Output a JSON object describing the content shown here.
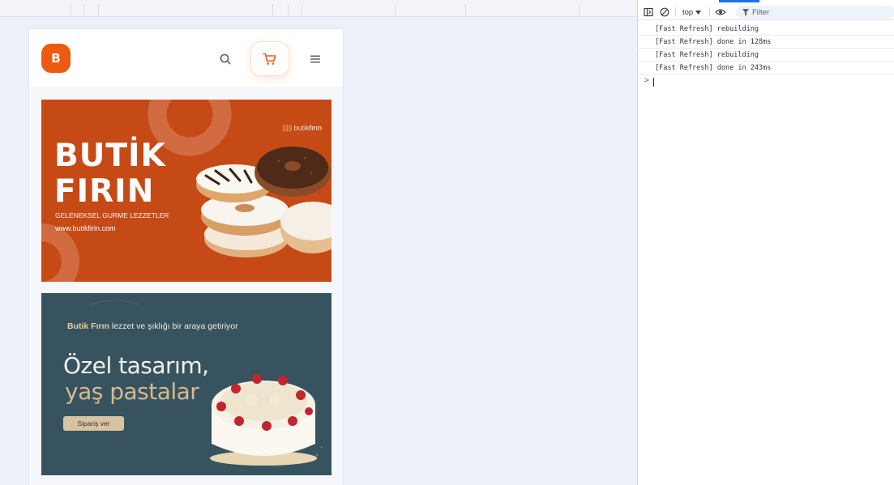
{
  "header": {
    "logo_letter": "B",
    "icons": [
      "search-icon",
      "cart-icon",
      "menu-icon"
    ],
    "accent_color": "#ee5a10"
  },
  "banner1": {
    "brand_prefix": "butik",
    "brand_suffix": "fırın",
    "title_line1": "BUTİK",
    "title_line2": "FIRIN",
    "subtitle": "GELENEKSEL GURME LEZZETLER",
    "url": "www.butikfirin.com",
    "background": "#c64a16"
  },
  "banner2": {
    "tag_brand": "Butik Fırın",
    "tag_rest": " lezzet ve şıklığı bir araya getiriyor",
    "title_line1": "Özel tasarım,",
    "title_line2": "yaş pastalar",
    "button_label": "Sipariş ver",
    "background": "#37535f"
  },
  "devtools": {
    "context": "top",
    "filter_placeholder": "Filter",
    "console_lines": [
      "[Fast Refresh] rebuilding",
      "[Fast Refresh] done in 128ms",
      "[Fast Refresh] rebuilding",
      "[Fast Refresh] done in 243ms"
    ],
    "prompt": ">"
  }
}
